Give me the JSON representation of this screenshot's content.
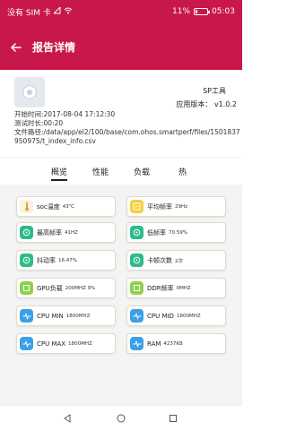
{
  "status_bar": {
    "carrier": "没有 SIM 卡",
    "battery": "11%",
    "time": "05:03"
  },
  "app_bar": {
    "title": "报告详情"
  },
  "report_info": {
    "app_name": "SP工具",
    "version_label": "应用版本：",
    "version_value": "v1.0.2",
    "start_time": "开始时间:2017-08-04 17:12:30",
    "duration": "测试时长:00:20",
    "file_path": "文件路径:/data/app/el2/100/base/com.ohos.smartperf/files/1501837950975/t_index_info.csv"
  },
  "tabs": [
    {
      "label": "概览",
      "active": true
    },
    {
      "label": "性能",
      "active": false
    },
    {
      "label": "负载",
      "active": false
    },
    {
      "label": "热",
      "active": false
    }
  ],
  "cards": [
    {
      "label": "soc温度",
      "value": "43℃",
      "icon": "thermometer-icon",
      "color": "#f7f3df"
    },
    {
      "label": "平均帧率",
      "value": "29Hz",
      "icon": "fps-icon",
      "color": "#f6cf3f"
    },
    {
      "label": "最高帧率",
      "value": "41HZ",
      "icon": "max-fps-icon",
      "color": "#2dbb8a"
    },
    {
      "label": "低帧率",
      "value": "70.59%",
      "icon": "low-fps-icon",
      "color": "#2dbb8a"
    },
    {
      "label": "抖动率",
      "value": "16.47%",
      "icon": "jitter-icon",
      "color": "#2dbb8a"
    },
    {
      "label": "卡顿次数",
      "value": "2次",
      "icon": "stutter-icon",
      "color": "#2dbb8a"
    },
    {
      "label": "GPU负载",
      "value": "200MHZ  9%",
      "icon": "gpu-icon",
      "color": "#8fd14f"
    },
    {
      "label": "DDR频率",
      "value": "0MHZ",
      "icon": "ddr-icon",
      "color": "#8fd14f"
    },
    {
      "label": "CPU MIN",
      "value": "1800MHZ",
      "icon": "cpu-min-icon",
      "color": "#3aa0e8"
    },
    {
      "label": "CPU MID",
      "value": "1800MHZ",
      "icon": "cpu-mid-icon",
      "color": "#3aa0e8"
    },
    {
      "label": "CPU MAX",
      "value": "1800MHZ",
      "icon": "cpu-max-icon",
      "color": "#3aa0e8"
    },
    {
      "label": "RAM",
      "value": "4237KB",
      "icon": "ram-icon",
      "color": "#3aa0e8"
    }
  ],
  "colors": {
    "accent": "#c8174a",
    "grid_background": "#f4f4f4"
  }
}
